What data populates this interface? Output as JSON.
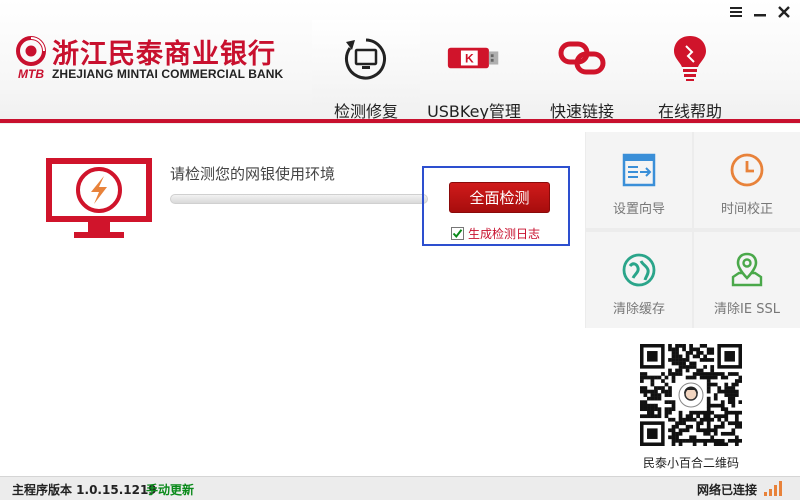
{
  "brand": {
    "name_cn": "浙江民泰商业银行",
    "abbr": "MTB",
    "name_en": "ZHEJIANG MINTAI COMMERCIAL BANK",
    "color": "#c8102e"
  },
  "window_controls": [
    {
      "name": "menu-icon"
    },
    {
      "name": "minimize-icon"
    },
    {
      "name": "close-icon"
    }
  ],
  "nav": {
    "items": [
      {
        "label": "检测修复",
        "icon": "monitor-repair-icon",
        "active": true
      },
      {
        "label": "USBKey管理",
        "icon": "usb-key-icon",
        "active": false
      },
      {
        "label": "快速链接",
        "icon": "link-icon",
        "active": false
      },
      {
        "label": "在线帮助",
        "icon": "lightbulb-icon",
        "active": false
      }
    ]
  },
  "detect": {
    "title": "请检测您的网银使用环境",
    "progress": 0,
    "button_label": "全面检测",
    "log_label": "生成检测日志",
    "log_checked": true
  },
  "tools": [
    {
      "label": "设置向导",
      "icon": "setup-wizard-icon"
    },
    {
      "label": "时间校正",
      "icon": "clock-icon"
    },
    {
      "label": "清除缓存",
      "icon": "clear-cache-icon"
    },
    {
      "label": "清除IE SSL",
      "icon": "map-pin-icon"
    }
  ],
  "qr": {
    "caption": "民泰小百合二维码"
  },
  "status": {
    "version_label": "主程序版本 1.0.15.1219",
    "update_label": "手动更新",
    "network_label": "网络已连接"
  },
  "colors": {
    "accent": "#c8102e",
    "highlight_border": "#2d4fcf",
    "tool_icon_blue": "#3a8fd8",
    "tool_icon_orange": "#e8823a",
    "tool_icon_teal": "#2aa58a",
    "tool_icon_green": "#4aa84a",
    "update_green": "#0a8a1a"
  }
}
